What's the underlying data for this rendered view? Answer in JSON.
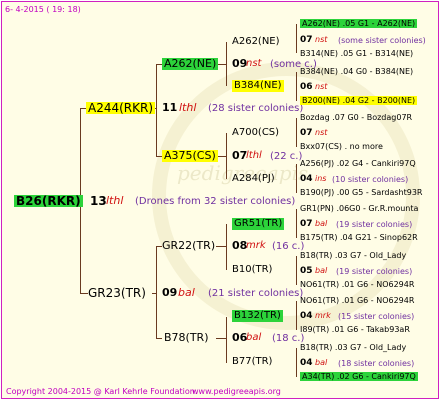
{
  "header": "6-  4-2015 ( 19: 18)",
  "footer": {
    "copyright": "Copyright 2004-2015 @ Karl Kehrle Foundation.",
    "site": "www.pedigreeapis.org"
  },
  "watermark": "pedigreeapis",
  "root": {
    "id": "B26(RKR)",
    "year": "13",
    "race": "lthl",
    "note": "(Drones from 32 sister colonies)"
  },
  "g1": [
    {
      "id": "A244(RKR)",
      "year": "11",
      "race": "lthl",
      "note": "(28 sister colonies)"
    },
    {
      "id": "GR23(TR)",
      "year": "09",
      "race": "bal",
      "note": "(21 sister colonies)"
    }
  ],
  "g2": [
    {
      "id": "A262(NE)",
      "year": "09",
      "race": "nst",
      "note": "(some c.)"
    },
    {
      "id": "A375(CS)",
      "year": "07",
      "race": "lthl",
      "note": "(22 c.)"
    },
    {
      "id": "GR22(TR)",
      "year": "08",
      "race": "mrk",
      "note": "(16 c.)"
    },
    {
      "id": "B78(TR)",
      "year": "06",
      "race": "bal",
      "note": "(18 c.)"
    }
  ],
  "g3": [
    {
      "id": "A262(NE)"
    },
    {
      "id": "B384(NE)"
    },
    {
      "id": "A700(CS)"
    },
    {
      "id": "A284(PJ)"
    },
    {
      "id": "GR51(TR)"
    },
    {
      "id": "B10(TR)"
    },
    {
      "id": "B132(TR)"
    },
    {
      "id": "B77(TR)"
    }
  ],
  "g4": [
    {
      "row1": "A262(NE) .05    G1 - A262(NE)",
      "year": "07",
      "race": "nst",
      "note": "(some sister colonies)",
      "row3": "B314(NE) .05    G1 - B314(NE)"
    },
    {
      "row1": "B384(NE) .04    G0 - B384(NE)",
      "year": "06",
      "race": "nst",
      "note": "",
      "row3": "B200(NE) .04    G2 - B200(NE)"
    },
    {
      "row1": "Bozdag .07      G0 - Bozdag07R",
      "year": "07",
      "race": "nst",
      "note": "",
      "row3": "Bxx07(CS) .          no more"
    },
    {
      "row1": "A256(PJ) .02   G4 - Cankiri97Q",
      "year": "04",
      "race": "ins",
      "note": "(10 sister colonies)",
      "row3": "B190(PJ) .00 G5 - Sardasht93R"
    },
    {
      "row1": "GR1(PN) .06G0 - Gr.R.mounta",
      "year": "07",
      "race": "bal",
      "note": "(19 sister colonies)",
      "row3": "B175(TR) .04  G21 - Sinop62R"
    },
    {
      "row1": "B18(TR) .03      G7 - Old_Lady",
      "year": "05",
      "race": "bal",
      "note": "(19 sister colonies)",
      "row3": "NO61(TR) .01    G6 - NO6294R"
    },
    {
      "row1": "NO61(TR) .01    G6 - NO6294R",
      "year": "04",
      "race": "mrk",
      "note": "(15 sister colonies)",
      "row3": "I89(TR) .01     G6 - Takab93aR"
    },
    {
      "row1": "B18(TR) .03      G7 - Old_Lady",
      "year": "04",
      "race": "bal",
      "note": "(18 sister colonies)",
      "row3": "A34(TR) .02   G6 - Cankiri97Q"
    }
  ]
}
